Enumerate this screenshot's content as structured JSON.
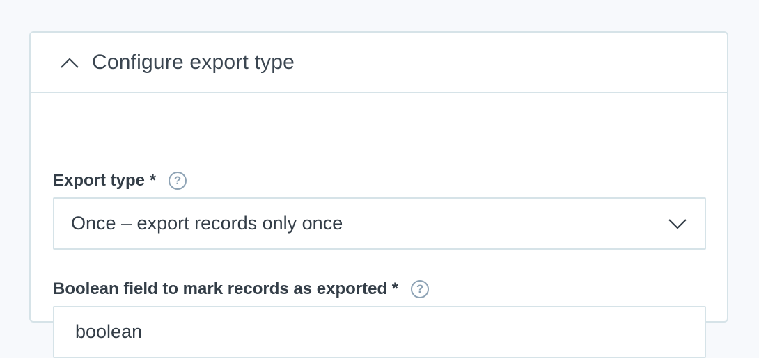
{
  "section": {
    "title": "Configure export type",
    "collapse_icon": "chevron-up-icon"
  },
  "export_type": {
    "label": "Export type *",
    "help_icon": "help-icon",
    "help_glyph": "?",
    "selected_value": "Once – export records only once",
    "dropdown_icon": "chevron-down-icon"
  },
  "boolean_field": {
    "label": "Boolean field to mark records as exported *",
    "help_icon": "help-icon",
    "help_glyph": "?",
    "value": "boolean",
    "placeholder": ""
  },
  "colors": {
    "border": "#d6e3e8",
    "text": "#333d47",
    "help": "#8ea3b5",
    "background": "#f7f9fc"
  }
}
